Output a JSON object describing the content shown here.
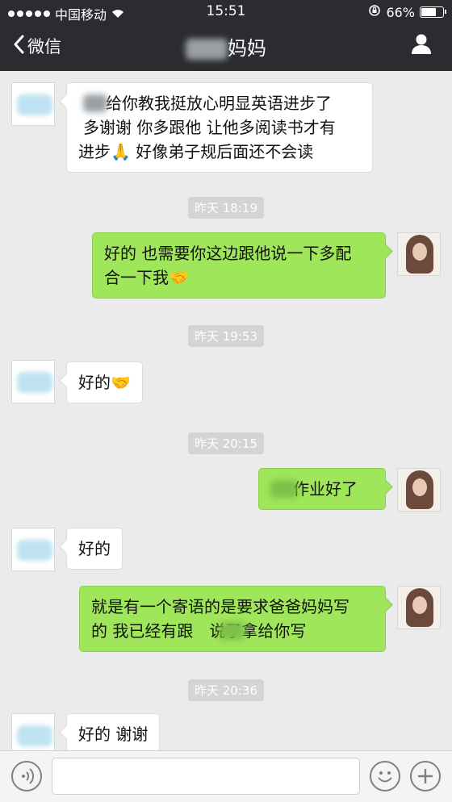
{
  "status_bar": {
    "carrier": "中国移动",
    "time": "15:51",
    "battery": "66%",
    "battery_level": 0.66
  },
  "nav": {
    "back_label": "微信",
    "title_suffix": "妈妈"
  },
  "messages": [
    {
      "side": "left",
      "lines": [
        "给你教我挺放心明显英语进步了",
        "多谢谢 你多跟他 让他多阅读书才有",
        "进步🙏 好像弟子规后面还不会读"
      ]
    },
    {
      "timestamp": "昨天 18:19"
    },
    {
      "side": "right",
      "lines": [
        "好的 也需要你这边跟他说一下多配",
        "合一下我🤝"
      ]
    },
    {
      "timestamp": "昨天 19:53"
    },
    {
      "side": "left",
      "lines": [
        "好的🤝"
      ]
    },
    {
      "timestamp": "昨天 20:15"
    },
    {
      "side": "right",
      "lines": [
        "作业好了"
      ]
    },
    {
      "side": "left",
      "lines": [
        "好的"
      ]
    },
    {
      "side": "right",
      "lines": [
        "就是有一个寄语的是要求爸爸妈妈写",
        "的 我已经有跟　说了拿给你写"
      ]
    },
    {
      "timestamp": "昨天 20:36"
    },
    {
      "side": "left",
      "lines": [
        "好的 谢谢"
      ]
    }
  ],
  "icons": {
    "back": "chevron-left-icon",
    "contact": "user-icon",
    "voice": "voice-icon",
    "emoji": "smiley-icon",
    "more": "plus-icon"
  },
  "colors": {
    "nav_bg": "#2b2b30",
    "chat_bg": "#ebebeb",
    "bubble_right": "#9fe65a",
    "bubble_left": "#ffffff"
  }
}
